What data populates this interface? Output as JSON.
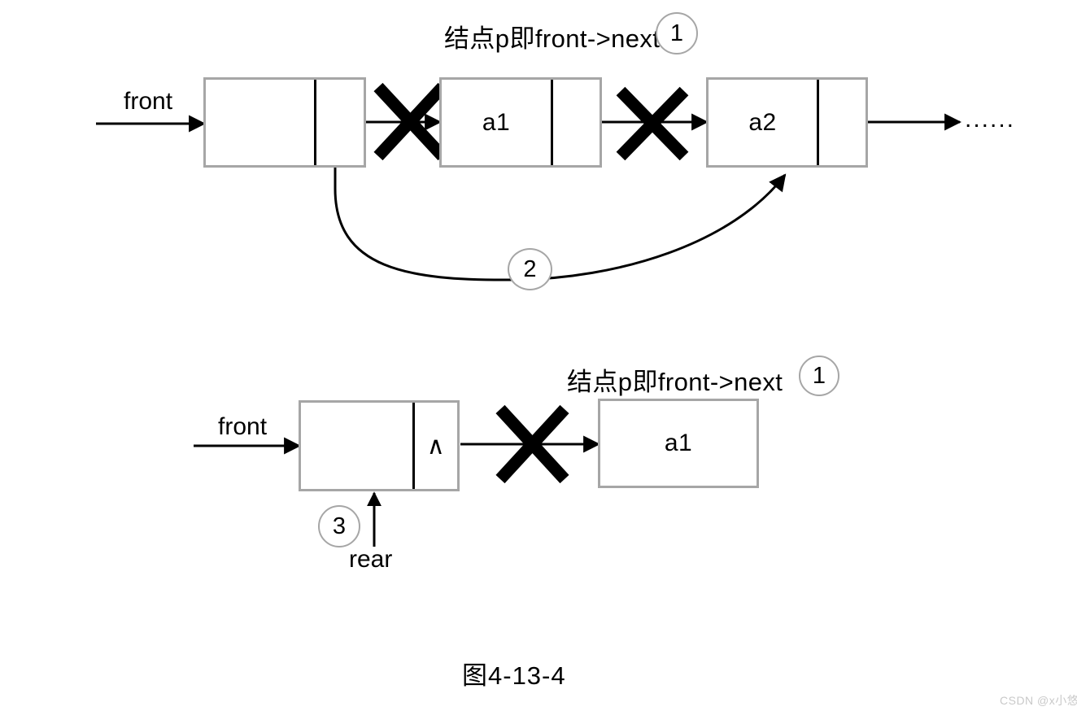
{
  "figure": {
    "caption": "图4-13-4",
    "watermark": "CSDN @x小悠"
  },
  "row1": {
    "title": "结点p即front->next",
    "title_step": "1",
    "front_label": "front",
    "tail_ellipsis": "......",
    "curve_step": "2",
    "nodes": [
      {
        "name": "head-node",
        "data": "",
        "pointer": ""
      },
      {
        "name": "node-a1",
        "data": "a1",
        "pointer": ""
      },
      {
        "name": "node-a2",
        "data": "a2",
        "pointer": ""
      }
    ],
    "crossed_links": [
      "head-to-a1",
      "a1-to-a2"
    ]
  },
  "row2": {
    "title": "结点p即front->next",
    "title_step": "1",
    "front_label": "front",
    "rear_label": "rear",
    "rear_step": "3",
    "nodes": [
      {
        "name": "head-node",
        "data": "",
        "pointer": "∧"
      },
      {
        "name": "node-a1",
        "data": "a1",
        "pointer": ""
      }
    ],
    "crossed_links": [
      "head-to-a1"
    ]
  }
}
